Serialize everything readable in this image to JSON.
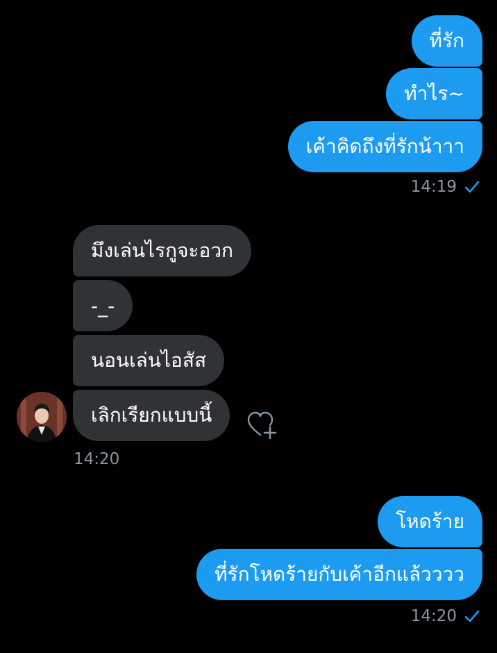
{
  "conversation": {
    "group1_sent": {
      "messages": [
        "ที่รัก",
        "ทำไร~",
        "เค้าคิดถึงที่รักน้าาา"
      ],
      "time": "14:19"
    },
    "group2_received": {
      "messages": [
        "มึงเล่นไรกูจะอวก",
        "-_-",
        "นอนเล่นไอสัส",
        "เลิกเรียกแบบนี้"
      ],
      "time": "14:20"
    },
    "group3_sent": {
      "messages": [
        "โหดร้าย",
        "ที่รักโหดร้ายกับเค้าอีกแล้วววว"
      ],
      "time": "14:20"
    }
  },
  "colors": {
    "background": "#000000",
    "sent_bubble": "#1d9bf0",
    "received_bubble": "#2f3336",
    "timestamp": "#8b98a5",
    "read_check": "#1d9bf0"
  },
  "icons": {
    "read_receipt": "check-icon",
    "add_reaction": "heart-plus-icon",
    "sender_avatar": "avatar"
  }
}
